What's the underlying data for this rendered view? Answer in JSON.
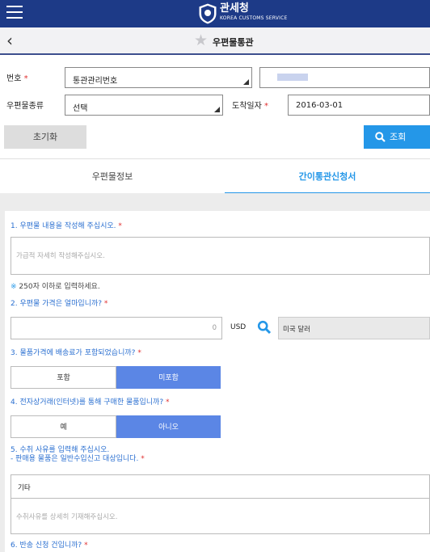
{
  "header": {
    "brand_title": "관세청",
    "brand_sub": "KOREA CUSTOMS SERVICE"
  },
  "subheader": {
    "title": "우편물통관"
  },
  "search": {
    "number_label": "번호",
    "number_type_value": "통관관리번호",
    "postal_type_label": "우편물종류",
    "postal_type_value": "선택",
    "arrival_date_label": "도착일자",
    "arrival_date_value": "2016-03-01",
    "reset_label": "초기화",
    "search_label": "조회",
    "required_mark": "*"
  },
  "tabs": {
    "postal_info": "우편물정보",
    "simple_customs": "간이통관신청서"
  },
  "form": {
    "q1": "1. 우편물 내용을 작성해 주십시오.",
    "q1_placeholder": "가급적 자세히 작성해주십시오.",
    "note_mark": "※",
    "note_text": " 250자 이하로 입력하세요.",
    "q2": "2. 우편물 가격은 얼마입니까?",
    "price_value": "0",
    "currency_code": "USD",
    "currency_name": "미국 달러",
    "q3": "3. 물품가격에 배송료가 포함되었습니까?",
    "q3_opt1": "포함",
    "q3_opt2": "미포함",
    "q4": "4. 전자상거래(인터넷)를 통해 구매한 물품입니까?",
    "q4_opt1": "예",
    "q4_opt2": "아니오",
    "q5_line1": "5. 수취 사유를 입력해 주십시오.",
    "q5_line2": "- 판매용 물품은 일반수입신고 대상입니다.",
    "q5_select": "기타",
    "q5_placeholder": "수취사유를 상세히 기재해주십시오.",
    "q6": "6. 반송 신청 건입니까?"
  },
  "colors": {
    "header_bg": "#1d3a87",
    "accent": "#2497e8",
    "selected": "#5b86e5",
    "required": "#e03030"
  }
}
